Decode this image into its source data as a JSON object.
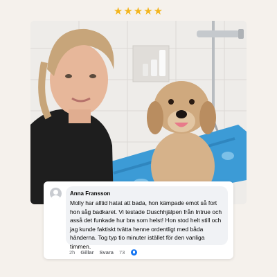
{
  "rating": {
    "stars": "★★★★★",
    "value": 5,
    "max": 5
  },
  "comment": {
    "author": "Anna Fransson",
    "text": "Molly har alltid hatat att bada, hon kämpade emot så fort hon såg badkaret. Vi testade Duschhjälpen från Intrue och asså det funkade hur bra som helst! Hon stod helt still och jag kunde faktiskt tvätta henne ordentligt med båda händerna. Tog typ tio minuter istället för den vanliga timmen.",
    "time": "2h",
    "like_label": "Gillar",
    "reply_label": "Svara",
    "reaction_count": "73",
    "reaction_icon": "like-icon"
  },
  "colors": {
    "stars": "#f3b51c",
    "accent": "#1877f2",
    "background": "#f5f1ec"
  }
}
